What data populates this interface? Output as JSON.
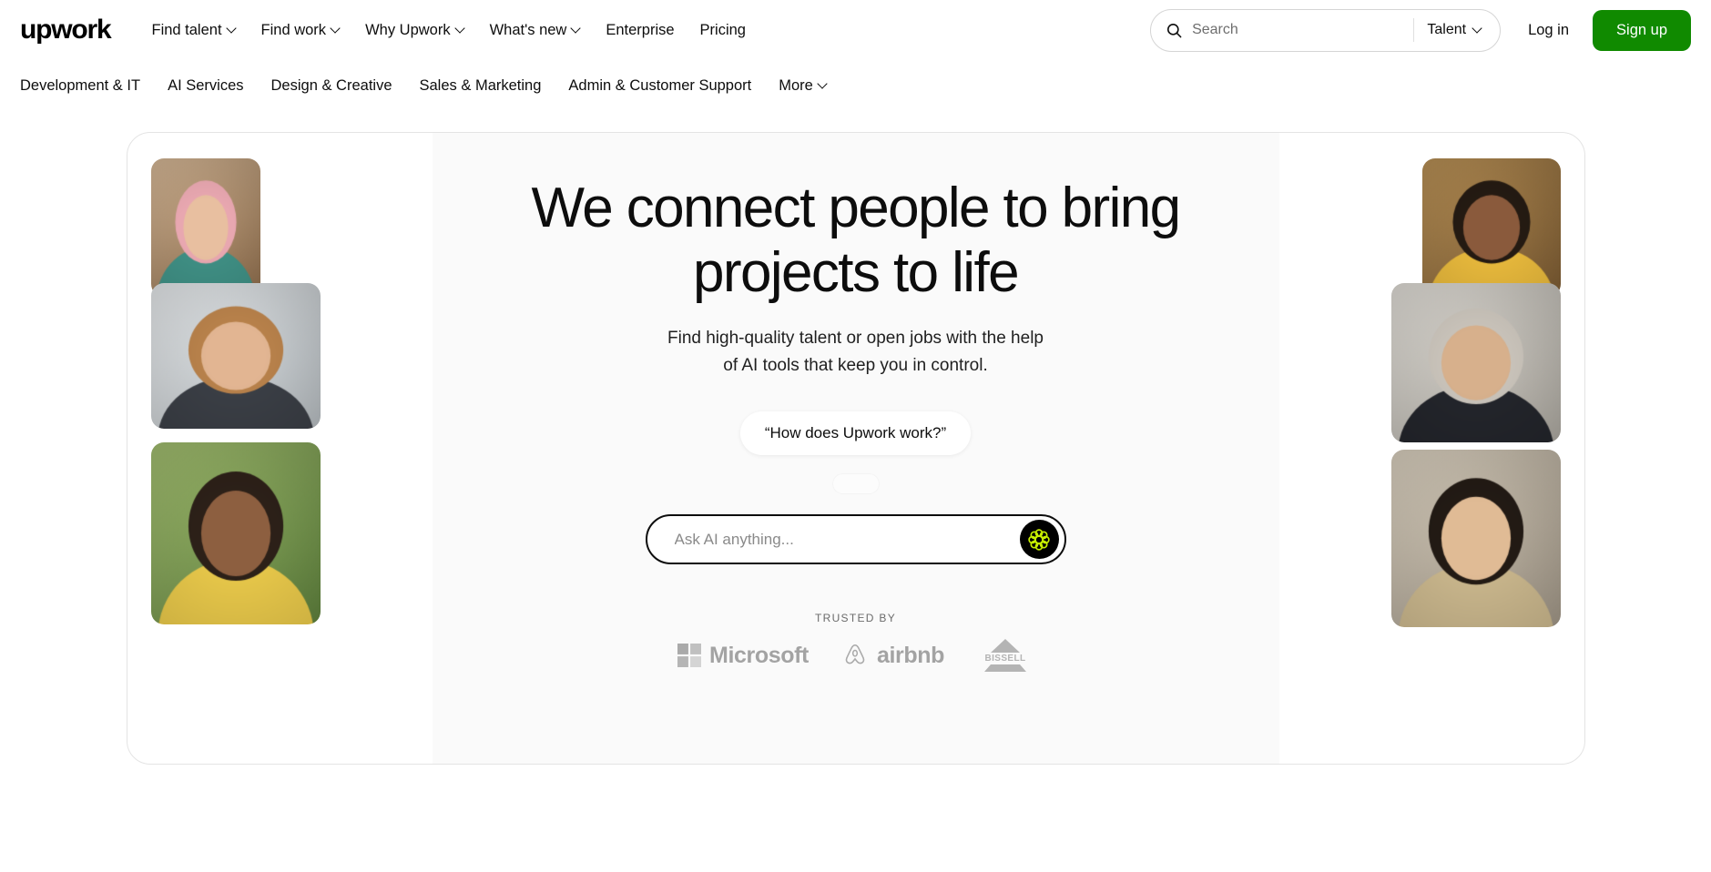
{
  "header": {
    "logo_text": "upwork",
    "nav": [
      {
        "label": "Find talent",
        "has_caret": true
      },
      {
        "label": "Find work",
        "has_caret": true
      },
      {
        "label": "Why Upwork",
        "has_caret": true
      },
      {
        "label": "What's new",
        "has_caret": true
      },
      {
        "label": "Enterprise",
        "has_caret": false
      },
      {
        "label": "Pricing",
        "has_caret": false
      }
    ],
    "search": {
      "placeholder": "Search",
      "value": "",
      "icon": "search-icon"
    },
    "search_scope": {
      "label": "Talent",
      "icon": "chevron-down-icon"
    },
    "login_label": "Log in",
    "signup_label": "Sign up",
    "signup_color": "#108a00"
  },
  "subnav": {
    "items": [
      {
        "label": "Development & IT",
        "has_caret": false
      },
      {
        "label": "AI Services",
        "has_caret": false
      },
      {
        "label": "Design & Creative",
        "has_caret": false
      },
      {
        "label": "Sales & Marketing",
        "has_caret": false
      },
      {
        "label": "Admin & Customer Support",
        "has_caret": false
      },
      {
        "label": "More",
        "has_caret": true
      }
    ]
  },
  "hero": {
    "headline": "We connect people to bring projects to life",
    "subheadline": "Find high-quality talent or open jobs with the help of AI tools that keep you in control.",
    "suggestion_chip": "“How does Upwork work?”",
    "ask_placeholder": "Ask AI anything...",
    "ask_value": "",
    "ask_button_icon": "ai-rosette-icon",
    "ask_button_bg": "#000000",
    "ask_button_icon_color": "#c8f000",
    "trusted_label": "TRUSTED BY",
    "brands": [
      {
        "name": "Microsoft",
        "icon": "microsoft-logo"
      },
      {
        "name": "airbnb",
        "icon": "airbnb-logo"
      },
      {
        "name": "BISSELL",
        "icon": "bissell-logo"
      }
    ]
  },
  "collage": {
    "left": [
      {
        "name": "photo-woman-pink-hair"
      },
      {
        "name": "photo-man-glasses-laptop"
      },
      {
        "name": "photo-woman-phone-garden"
      }
    ],
    "right": [
      {
        "name": "photo-woman-tablet"
      },
      {
        "name": "photo-two-colleagues"
      },
      {
        "name": "photo-woman-desk"
      }
    ]
  }
}
